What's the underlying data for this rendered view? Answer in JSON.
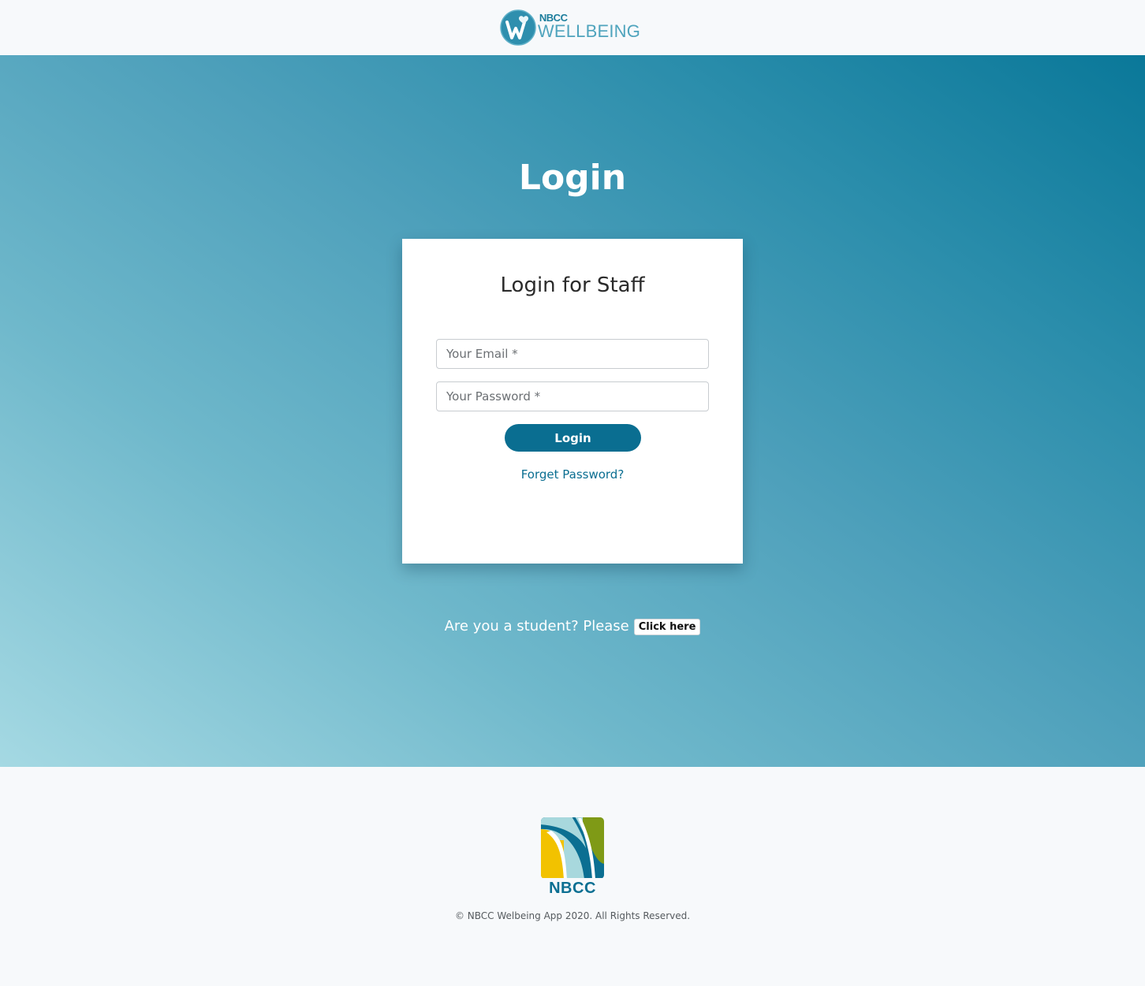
{
  "header": {
    "brand_top": "NBCC",
    "brand_bottom": "WELLBEING",
    "logo_icon": "wellbeing-heart-logo"
  },
  "hero": {
    "title": "Login"
  },
  "login_card": {
    "title": "Login for Staff",
    "email_placeholder": "Your Email *",
    "email_value": "",
    "password_placeholder": "Your Password *",
    "password_value": "",
    "login_button": "Login",
    "forget_link": "Forget Password?"
  },
  "student": {
    "prompt": "Are you a student? Please",
    "button": "Click here"
  },
  "footer": {
    "logo_text": "NBCC",
    "copyright": "© NBCC Welbeing App 2020. All Rights Reserved."
  },
  "colors": {
    "primary": "#0a6e91",
    "gradient_light": "#a5d9e3",
    "gradient_dark": "#0a7899",
    "footer_logo_yellow": "#f2c200",
    "footer_logo_green": "#7f9a16",
    "footer_logo_lightblue": "#a8d8dd"
  }
}
